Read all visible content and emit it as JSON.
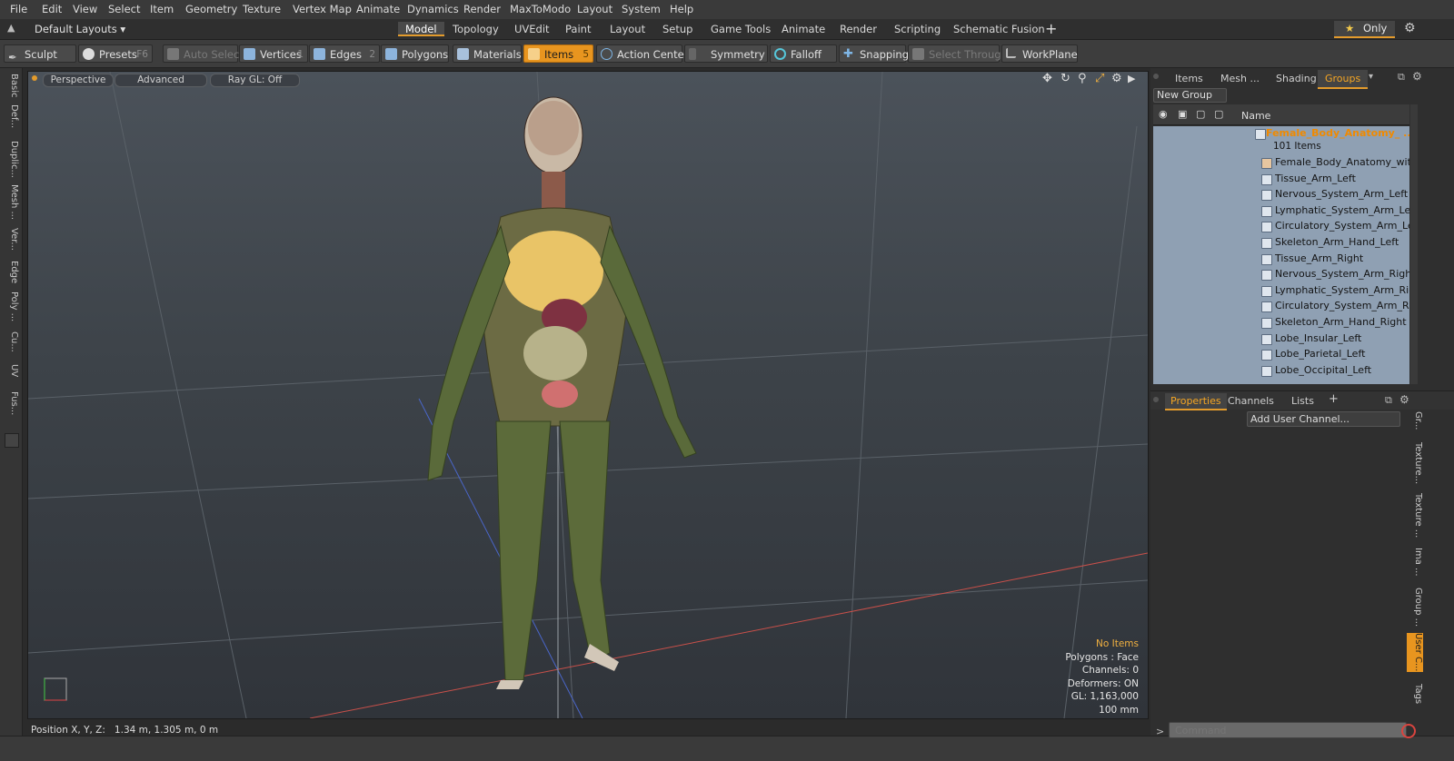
{
  "menu": [
    "File",
    "Edit",
    "View",
    "Select",
    "Item",
    "Geometry",
    "Texture",
    "Vertex Map",
    "Animate",
    "Dynamics",
    "Render",
    "MaxToModo",
    "Layout",
    "System",
    "Help"
  ],
  "layout_dropdown": "Default Layouts",
  "layout_tabs": [
    "Model",
    "Topology",
    "UVEdit",
    "Paint",
    "Layout",
    "Setup",
    "Game Tools",
    "Animate",
    "Render",
    "Scripting",
    "Schematic Fusion"
  ],
  "layout_plus": "+",
  "only_label": "Only",
  "toolbar": {
    "sculpt": "Sculpt",
    "presets": "Presets",
    "presets_key": "F6",
    "auto_select": "Auto Select",
    "vertices": "Vertices",
    "vertices_key": "1",
    "edges": "Edges",
    "edges_key": "2",
    "polygons": "Polygons",
    "materials": "Materials",
    "items": "Items",
    "items_key": "5",
    "action_center": "Action Center",
    "symmetry": "Symmetry",
    "falloff": "Falloff",
    "snapping": "Snapping",
    "select_through": "Select Through",
    "workplane": "WorkPlane"
  },
  "left_tabs": [
    "Basic",
    "Def...",
    "Duplic...",
    "Mesh ...",
    "Ver...",
    "Edge",
    "Poly ...",
    "Cu...",
    "UV",
    "Fus..."
  ],
  "viewport": {
    "perspective": "Perspective",
    "advanced": "Advanced",
    "raygl": "Ray GL: Off",
    "info_title": "No Items",
    "info_lines": [
      "Polygons : Face",
      "Channels: 0",
      "Deformers: ON",
      "GL: 1,163,000",
      "100 mm"
    ]
  },
  "right_tabs": [
    "Items",
    "Mesh ...",
    "Shading",
    "Groups"
  ],
  "new_group": "New Group",
  "name_header": "Name",
  "group": {
    "title": "Female_Body_Anatomy_ ...",
    "count": "101 Items",
    "items": [
      "Female_Body_Anatomy_wit ...",
      "Tissue_Arm_Left",
      "Nervous_System_Arm_Left",
      "Lymphatic_System_Arm_Left",
      "Circulatory_System_Arm_Left",
      "Skeleton_Arm_Hand_Left",
      "Tissue_Arm_Right",
      "Nervous_System_Arm_Right",
      "Lymphatic_System_Arm_Right",
      "Circulatory_System_Arm_Ri ...",
      "Skeleton_Arm_Hand_Right",
      "Lobe_Insular_Left",
      "Lobe_Parietal_Left",
      "Lobe_Occipital_Left"
    ]
  },
  "prop_tabs": [
    "Properties",
    "Channels",
    "Lists"
  ],
  "add_user_channel": "Add User Channel...",
  "prop_side_tabs": [
    "Gr...",
    "Texture...",
    "Texture ...",
    "Ima ...",
    "Group ...",
    "User C...",
    "Tags"
  ],
  "status_position": "Position X, Y, Z:   1.34 m, 1.305 m, 0 m",
  "command_placeholder": "Command",
  "colors": {
    "accent": "#e8951f",
    "orange_text": "#f5a623",
    "list_bg": "#8fa0b3"
  }
}
